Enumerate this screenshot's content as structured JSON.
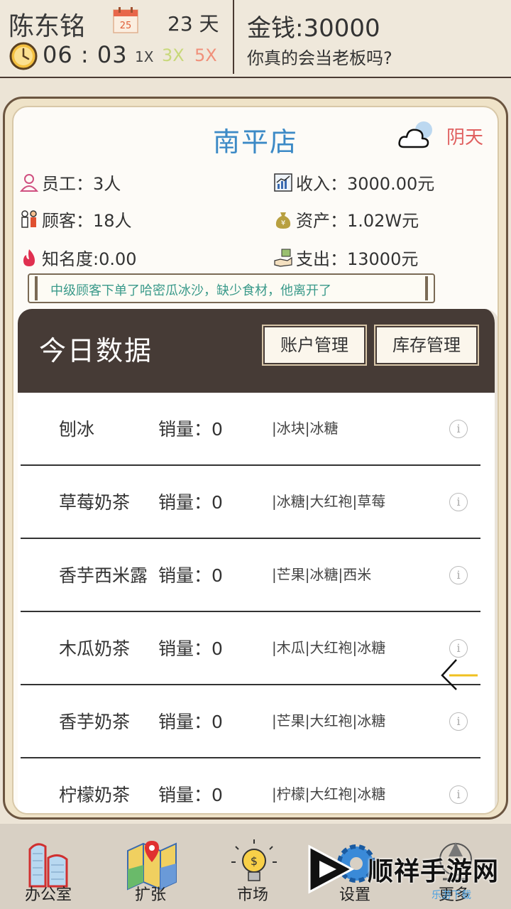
{
  "header": {
    "player_name": "陈东铭",
    "calendar_date": "25",
    "day_count": "23 天",
    "time": "06 : 03",
    "speed_1x": "1X",
    "speed_3x": "3X",
    "speed_5x": "5X",
    "money": "金钱:30000",
    "slogan": "你真的会当老板吗?"
  },
  "store": {
    "name": "南平店",
    "weather": "阴天",
    "employees": "员工：3人",
    "customers": "顾客：18人",
    "fame": "知名度:0.00",
    "income": "收入：3000.00元",
    "assets": "资产：1.02W元",
    "expense": "支出：13000元",
    "message": "中级顾客下单了哈密瓜冰沙，缺少食材，他离开了"
  },
  "today": {
    "title": "今日数据",
    "account_button": "账户管理",
    "inventory_button": "库存管理",
    "info_glyph": "i",
    "rows": [
      {
        "name": "刨冰",
        "sales": "销量：0",
        "ingredients": "|冰块|冰糖"
      },
      {
        "name": "草莓奶茶",
        "sales": "销量：0",
        "ingredients": "|冰糖|大红袍|草莓"
      },
      {
        "name": "香芋西米露",
        "sales": "销量：0",
        "ingredients": "|芒果|冰糖|西米"
      },
      {
        "name": "木瓜奶茶",
        "sales": "销量：0",
        "ingredients": "|木瓜|大红袍|冰糖"
      },
      {
        "name": "香芋奶茶",
        "sales": "销量：0",
        "ingredients": "|芒果|大红袍|冰糖"
      },
      {
        "name": "柠檬奶茶",
        "sales": "销量：0",
        "ingredients": "|柠檬|大红袍|冰糖"
      }
    ]
  },
  "nav": {
    "office": "办公室",
    "expand": "扩张",
    "market": "市场",
    "settings": "设置",
    "more": "更多"
  },
  "watermark": {
    "text": "顺祥手游网",
    "sub": "乐游下载"
  },
  "colors": {
    "store_title": "#3c8ac6",
    "weather": "#e06060",
    "message": "#3a9a8a",
    "panel_header": "#463b36",
    "speed_3x": "#c8d87a",
    "speed_5x": "#f0907a"
  }
}
